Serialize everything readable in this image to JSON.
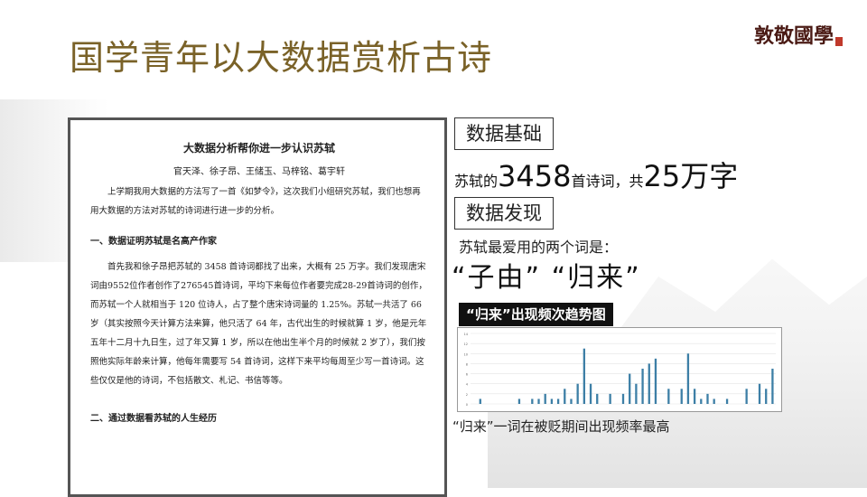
{
  "slide": {
    "title": "国学青年以大数据赏析古诗",
    "logo_text": "敦敬國學"
  },
  "document": {
    "heading": "大数据分析帮你进一步认识苏轼",
    "authors": "官天泽、徐子昂、王储玉、马梓铭、葛宇轩",
    "intro": "上学期我用大数据的方法写了一首《如梦令》，这次我们小组研究苏轼，我们也想再用大数据的方法对苏轼的诗词进行进一步的分析。",
    "section1_title": "一、数据证明苏轼是名高产作家",
    "section1_body": "首先我和徐子昂把苏轼的 3458 首诗词都找了出来，大概有 25 万字。我们发现唐宋词由9552位作者创作了276545首诗词，平均下来每位作者要完成28-29首诗词的创作，而苏轼一个人就相当于 120 位诗人，占了整个唐宋诗词量的 1.25%。苏轼一共活了 66 岁（其实按照今天计算方法来算，他只活了 64 年，古代出生的时候就算 1 岁，他是元年五年十二月十九日生，过了年又算 1 岁，所以在他出生半个月的时候就 2 岁了），我们按照他实际年龄来计算，他每年需要写 54 首诗词，这样下来平均每周至少写一首诗词。这些仅仅是他的诗词，不包括散文、札记、书信等等。",
    "section2_title": "二、通过数据看苏轼的人生经历"
  },
  "panel": {
    "label_basis": "数据基础",
    "stat_prefix": "苏轼的",
    "stat_count": "3458",
    "stat_mid": "首诗词，共",
    "stat_words": "25万字",
    "label_findings": "数据发现",
    "favorite_intro": "苏轼最爱用的两个词是：",
    "favorite_words": "“子由” “归来”",
    "chart_label": "“归来”出现频次趋势图",
    "caption": "“归来”一词在被贬期间出现频率最高"
  },
  "chart_data": {
    "type": "bar",
    "ylim": [
      0,
      14
    ],
    "y_ticks": [
      "14",
      "12",
      "10",
      "8",
      "6",
      "4",
      "2",
      "0"
    ],
    "grid": true,
    "values": [
      0,
      1,
      0,
      0,
      0,
      0,
      0,
      1,
      0,
      1,
      1,
      2,
      1,
      1,
      3,
      1,
      4,
      11,
      4,
      2,
      0,
      2,
      0,
      2,
      6,
      4,
      7,
      8,
      9,
      0,
      3,
      0,
      3,
      10,
      3,
      1,
      2,
      1,
      0,
      1,
      0,
      0,
      3,
      0,
      4,
      3,
      7
    ],
    "color": "#3d7fa6"
  }
}
